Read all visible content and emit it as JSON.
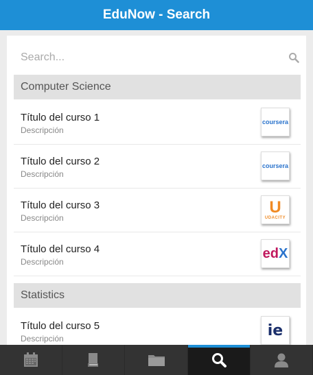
{
  "app": {
    "title": "EduNow - Search"
  },
  "search": {
    "placeholder": "Search..."
  },
  "sections": [
    {
      "label": "Computer Science"
    },
    {
      "label": "Statistics"
    }
  ],
  "courses": [
    {
      "title": "Título del curso 1",
      "desc": "Descripción",
      "provider": "coursera",
      "logo_text": "coursera"
    },
    {
      "title": "Título del curso 2",
      "desc": "Descripción",
      "provider": "coursera",
      "logo_text": "coursera"
    },
    {
      "title": "Título del curso 3",
      "desc": "Descripción",
      "provider": "udacity",
      "logo_text": "UDACITY"
    },
    {
      "title": "Título del curso 4",
      "desc": "Descripción",
      "provider": "edx",
      "logo_text": "edX"
    },
    {
      "title": "Título del curso 5",
      "desc": "Descripción",
      "provider": "ie",
      "logo_text": "ie"
    }
  ],
  "tabs": [
    {
      "icon": "calendar-icon",
      "active": false
    },
    {
      "icon": "book-icon",
      "active": false
    },
    {
      "icon": "folder-icon",
      "active": false
    },
    {
      "icon": "search-icon",
      "active": true
    },
    {
      "icon": "user-icon",
      "active": false
    }
  ],
  "colors": {
    "accent": "#1e8fd6",
    "tabbar": "#333333",
    "section": "#e1e1e1"
  }
}
